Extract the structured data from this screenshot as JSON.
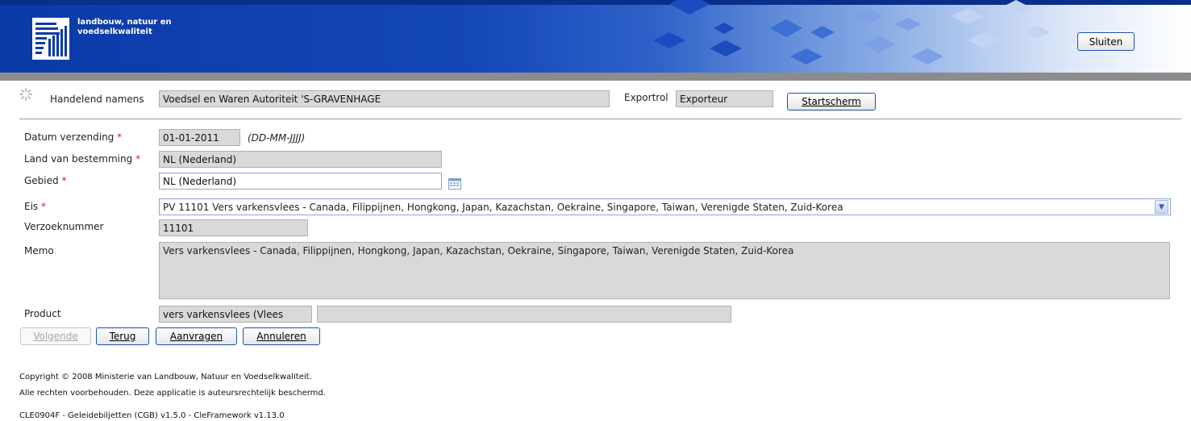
{
  "header": {
    "brand_line1": "landbouw, natuur en",
    "brand_line2": "voedselkwaliteit",
    "close_label": "Sluiten"
  },
  "acting": {
    "label": "Handelend namens",
    "value": "Voedsel en Waren Autoriteit 'S-GRAVENHAGE",
    "export_role_label": "Exportrol",
    "export_role_value": "Exporteur",
    "start_button": "Startscherm"
  },
  "form": {
    "date_label": "Datum verzending",
    "date_value": "01-01-2011",
    "date_hint": "(DD-MM-JJJJ)",
    "dest_label": "Land van bestemming",
    "dest_value": "NL (Nederland)",
    "area_label": "Gebied",
    "area_value": "NL (Nederland)",
    "req_label": "Eis",
    "req_value": "PV 11101 Vers varkensvlees - Canada, Filippijnen, Hongkong, Japan, Kazachstan, Oekraine, Singapore, Taiwan, Verenigde Staten, Zuid-Korea",
    "reqnum_label": "Verzoeknummer",
    "reqnum_value": "11101",
    "memo_label": "Memo",
    "memo_value": "Vers varkensvlees - Canada, Filippijnen, Hongkong, Japan, Kazachstan, Oekraine, Singapore, Taiwan, Verenigde Staten, Zuid-Korea",
    "product_label": "Product",
    "product_value": "vers varkensvlees (Vlees",
    "product_extra": "",
    "required_mark": "*"
  },
  "actions": {
    "next": "Volgende",
    "back": "Terug",
    "apply": "Aanvragen",
    "cancel": "Annuleren"
  },
  "footer": {
    "copyright": "Copyright © 2008 Ministerie van Landbouw, Natuur en Voedselkwaliteit.",
    "rights": "Alle rechten voorbehouden. Deze applicatie is auteursrechtelijk beschermd.",
    "version": "CLE0904F - Geleidebiljetten (CGB) v1.5.0 - CleFramework v1.13.0"
  },
  "colors": {
    "banner": "#1447b8",
    "required": "#d02020",
    "readonly_field": "#d9d9d9"
  },
  "icons": {
    "logo": "ministry-logo",
    "spinner": "loading-spinner-icon",
    "calendar": "calendar-icon",
    "dropdown": "chevron-down-icon"
  }
}
